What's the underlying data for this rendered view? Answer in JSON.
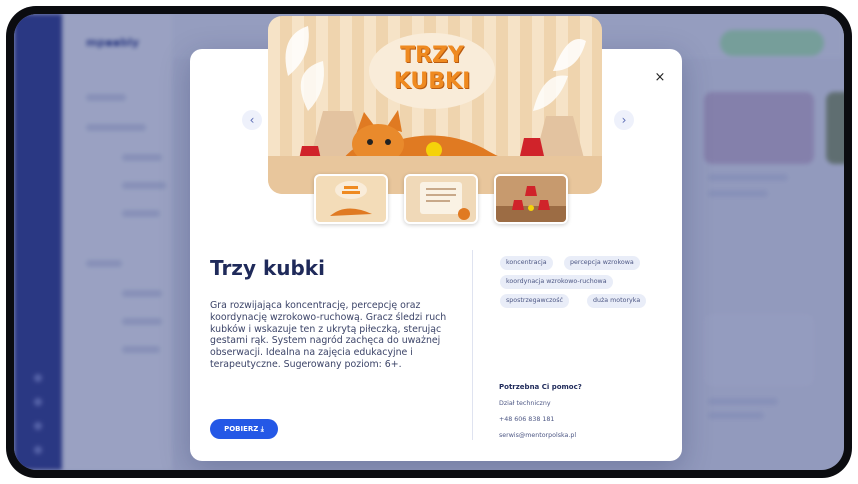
{
  "background": {
    "logo": "mp▪▪bly"
  },
  "modal": {
    "close_icon": "×",
    "prev_icon": "‹",
    "next_icon": "›",
    "hero_title_line1": "TRZY",
    "hero_title_line2": "KUBKI",
    "title": "Trzy kubki",
    "description": "Gra rozwijająca koncentrację, percepcję oraz koordynację wzrokowo-ruchową. Gracz śledzi ruch kubków i wskazuje ten z ukrytą piłeczką, sterując gestami rąk. System nagród zachęca do uważnej obserwacji. Idealna na zajęcia edukacyjne i terapeutyczne. Sugerowany poziom: 6+.",
    "download_label": "POBIERZ ⤓",
    "tags": [
      "koncentracja",
      "percepcja wzrokowa",
      "koordynacja wzrokowo-ruchowa",
      "spostrzegawczość",
      "duża motoryka"
    ],
    "help": {
      "title": "Potrzebna Ci pomoc?",
      "department": "Dział techniczny",
      "phone": "+48 606 838 181",
      "email": "serwis@mentorpolska.pl"
    }
  },
  "colors": {
    "accent": "#2458e6",
    "title": "#1f2a5a",
    "hero_orange": "#ef8a20"
  }
}
